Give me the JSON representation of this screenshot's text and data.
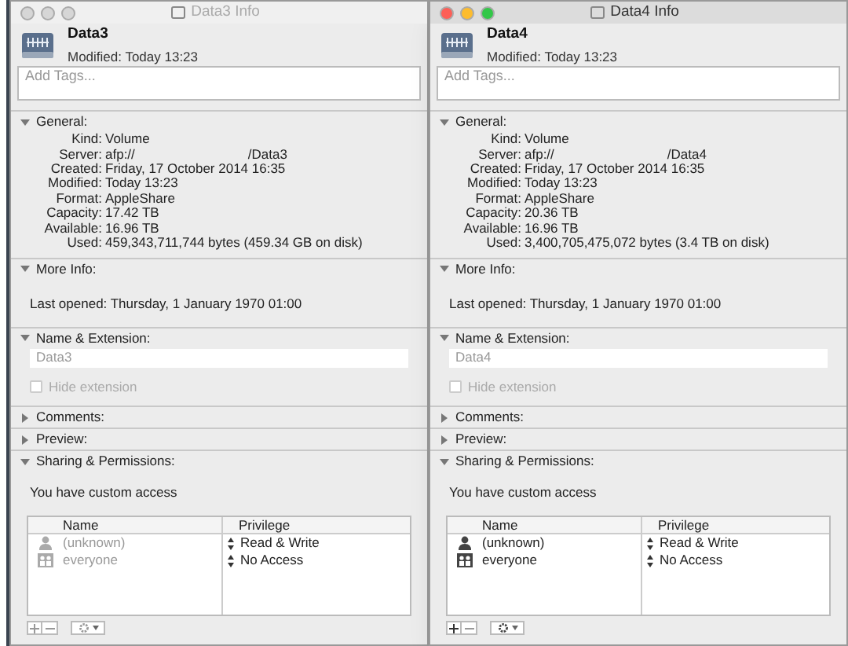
{
  "windows": [
    {
      "title": "Data3 Info",
      "active": false,
      "name": "Data3",
      "modified": "Modified: Today 13:23",
      "tags_placeholder": "Add Tags...",
      "sections": [
        {
          "kind": "general",
          "title": "General:",
          "expanded": true,
          "rows": [
            {
              "label": "Kind:",
              "value": "Volume"
            },
            {
              "label": "Server:",
              "value": "afp://",
              "suffix": "/Data3"
            },
            {
              "label": "Created:",
              "value": "Friday, 17 October 2014 16:35"
            },
            {
              "label": "Modified:",
              "value": "Today 13:23"
            },
            {
              "label": "Format:",
              "value": "AppleShare"
            },
            {
              "label": "Capacity:",
              "value": "17.42 TB"
            },
            {
              "label": "Available:",
              "value": "16.96 TB"
            },
            {
              "label": "Used:",
              "value": "459,343,711,744 bytes (459.34 GB on disk)"
            }
          ]
        },
        {
          "kind": "text",
          "title": "More Info:",
          "expanded": true,
          "text": "Last opened: Thursday, 1 January 1970 01:00"
        },
        {
          "kind": "name",
          "title": "Name & Extension:",
          "expanded": true,
          "field_value": "Data3",
          "checkbox_label": "Hide extension",
          "checked": false
        },
        {
          "kind": "collapsed",
          "title": "Comments:",
          "expanded": false
        },
        {
          "kind": "collapsed",
          "title": "Preview:",
          "expanded": false
        },
        {
          "kind": "sharing",
          "title": "Sharing & Permissions:",
          "expanded": true,
          "text": "You have custom access",
          "columns": [
            "Name",
            "Privilege"
          ],
          "rows": [
            {
              "kind": "user",
              "name": "(unknown)",
              "privilege": "Read & Write"
            },
            {
              "kind": "group",
              "name": "everyone",
              "privilege": "No Access"
            }
          ]
        }
      ]
    },
    {
      "title": "Data4 Info",
      "active": true,
      "name": "Data4",
      "modified": "Modified: Today 13:23",
      "tags_placeholder": "Add Tags...",
      "sections": [
        {
          "kind": "general",
          "title": "General:",
          "expanded": true,
          "rows": [
            {
              "label": "Kind:",
              "value": "Volume"
            },
            {
              "label": "Server:",
              "value": "afp://",
              "suffix": "/Data4"
            },
            {
              "label": "Created:",
              "value": "Friday, 17 October 2014 16:35"
            },
            {
              "label": "Modified:",
              "value": "Today 13:23"
            },
            {
              "label": "Format:",
              "value": "AppleShare"
            },
            {
              "label": "Capacity:",
              "value": "20.36 TB"
            },
            {
              "label": "Available:",
              "value": "16.96 TB"
            },
            {
              "label": "Used:",
              "value": "3,400,705,475,072 bytes (3.4 TB on disk)"
            }
          ]
        },
        {
          "kind": "text",
          "title": "More Info:",
          "expanded": true,
          "text": "Last opened: Thursday, 1 January 1970 01:00"
        },
        {
          "kind": "name",
          "title": "Name & Extension:",
          "expanded": true,
          "field_value": "Data4",
          "checkbox_label": "Hide extension",
          "checked": false
        },
        {
          "kind": "collapsed",
          "title": "Comments:",
          "expanded": false
        },
        {
          "kind": "collapsed",
          "title": "Preview:",
          "expanded": false
        },
        {
          "kind": "sharing",
          "title": "Sharing & Permissions:",
          "expanded": true,
          "text": "You have custom access",
          "columns": [
            "Name",
            "Privilege"
          ],
          "rows": [
            {
              "kind": "user",
              "name": "(unknown)",
              "privilege": "Read & Write"
            },
            {
              "kind": "group",
              "name": "everyone",
              "privilege": "No Access"
            }
          ]
        }
      ]
    }
  ]
}
